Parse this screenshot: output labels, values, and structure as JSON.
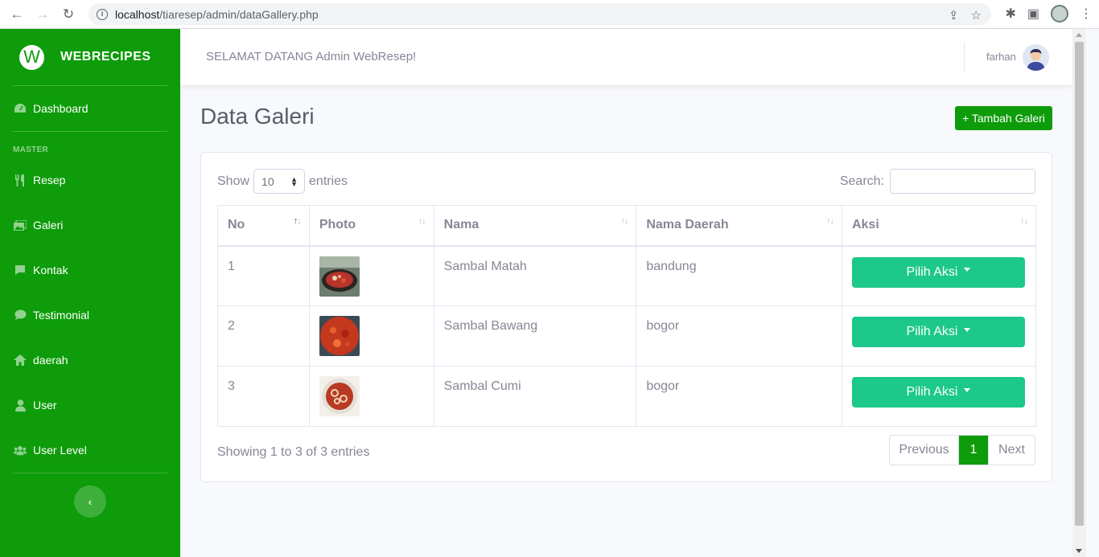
{
  "browser": {
    "url_host": "localhost",
    "url_path": "/tiaresep/admin/dataGallery.php"
  },
  "sidebar": {
    "brand": "WEBRECIPES",
    "brand_logo_letter": "W",
    "dashboard": "Dashboard",
    "heading": "MASTER",
    "items": [
      {
        "label": "Resep",
        "icon": "utensils-icon"
      },
      {
        "label": "Galeri",
        "icon": "images-icon"
      },
      {
        "label": "Kontak",
        "icon": "comment-icon"
      },
      {
        "label": "Testimonial",
        "icon": "comment-dots-icon"
      },
      {
        "label": "daerah",
        "icon": "home-icon"
      },
      {
        "label": "User",
        "icon": "user-icon"
      },
      {
        "label": "User Level",
        "icon": "users-icon"
      }
    ],
    "toggle_glyph": "‹"
  },
  "topbar": {
    "welcome": "SELAMAT DATANG Admin WebResep!",
    "user_name": "farhan"
  },
  "page": {
    "title": "Data Galeri",
    "add_button": "+ Tambah Galeri"
  },
  "table_controls": {
    "show_label": "Show",
    "entries_value": "10",
    "entries_label": "entries",
    "search_label": "Search:"
  },
  "table": {
    "headers": [
      "No",
      "Photo",
      "Nama",
      "Nama Daerah",
      "Aksi"
    ],
    "rows": [
      {
        "no": "1",
        "nama": "Sambal Matah",
        "daerah": "bandung",
        "action": "Pilih Aksi"
      },
      {
        "no": "2",
        "nama": "Sambal Bawang",
        "daerah": "bogor",
        "action": "Pilih Aksi"
      },
      {
        "no": "3",
        "nama": "Sambal Cumi",
        "daerah": "bogor",
        "action": "Pilih Aksi"
      }
    ]
  },
  "footer": {
    "info": "Showing 1 to 3 of 3 entries",
    "previous": "Previous",
    "page": "1",
    "next": "Next"
  },
  "colors": {
    "brand_green": "#0e9c0a",
    "action_green": "#1cc88a"
  }
}
